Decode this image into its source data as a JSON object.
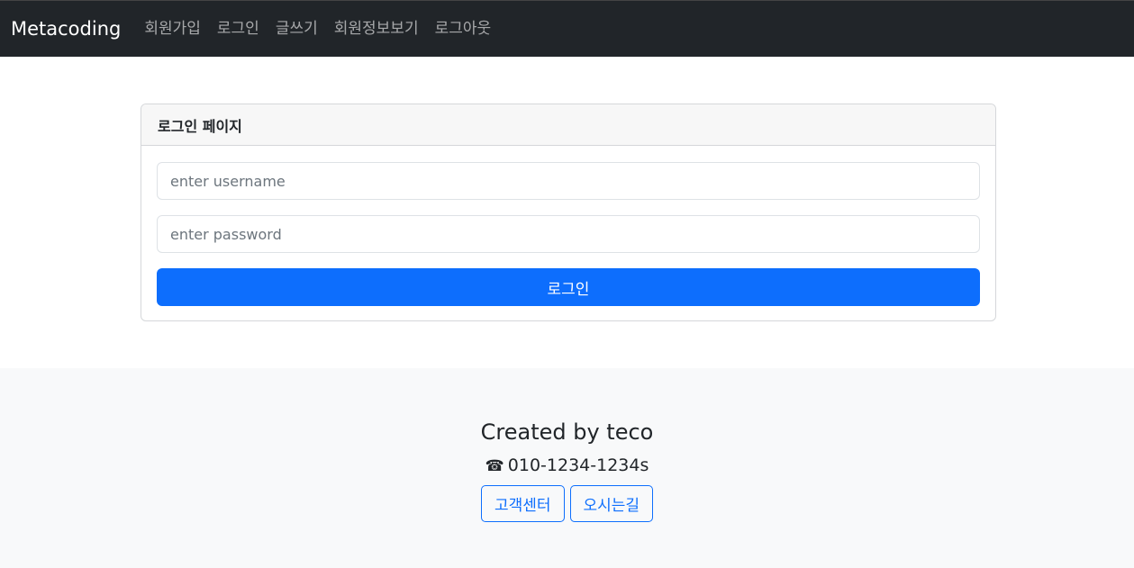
{
  "navbar": {
    "brand": "Metacoding",
    "links": [
      "회원가입",
      "로그인",
      "글쓰기",
      "회원정보보기",
      "로그아웃"
    ]
  },
  "login_card": {
    "title": "로그인 페이지",
    "username_placeholder": "enter username",
    "username_value": "",
    "password_placeholder": "enter password",
    "password_value": "",
    "submit_label": "로그인"
  },
  "footer": {
    "credit": "Created by teco",
    "phone_icon": "☎",
    "phone": "010-1234-1234s",
    "buttons": [
      "고객센터",
      "오시는길"
    ]
  },
  "colors": {
    "navbar_bg": "#212529",
    "primary": "#0d6efd",
    "footer_bg": "#f8f9fa"
  }
}
